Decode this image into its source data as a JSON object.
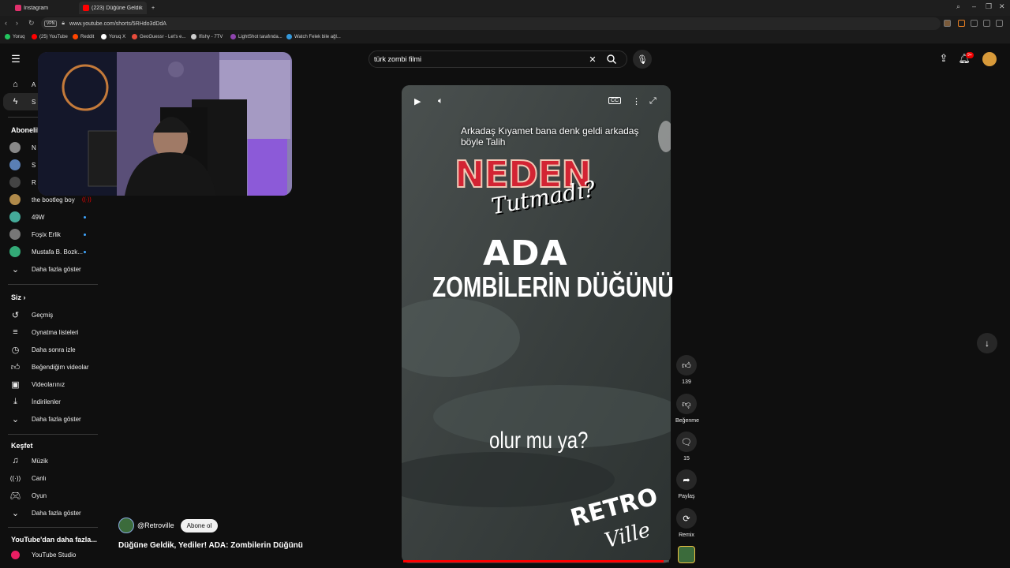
{
  "browser": {
    "tabs": [
      {
        "label": "Instagram",
        "color": "#e1306c"
      },
      {
        "label": "(223) Düğüne Geldik, Yedi",
        "color": "#ff0000"
      }
    ],
    "new_tab": "+",
    "vpn_badge": "VPN",
    "url": "www.youtube.com/shorts/5RHdo3dDdA",
    "bookmarks": [
      {
        "label": "Yoruq",
        "color": "#22c55e"
      },
      {
        "label": "(25) YouTube",
        "color": "#ff0000"
      },
      {
        "label": "Reddit",
        "color": "#ff4500"
      },
      {
        "label": "Yoruq X",
        "color": "#ffffff"
      },
      {
        "label": "GeoGuessr - Let's e...",
        "color": "#e74c3c"
      },
      {
        "label": "Ifishy - 7TV",
        "color": "#cccccc"
      },
      {
        "label": "LightShot tarafında...",
        "color": "#8e44ad"
      },
      {
        "label": "Watch Felek bile ağl...",
        "color": "#3498db"
      }
    ]
  },
  "search": {
    "value": "türk zombi filmi"
  },
  "header": {
    "notif_count": "9+"
  },
  "sidebar": {
    "home_initial": "A",
    "shorts_initial": "S",
    "subs_head": "Abonelil",
    "subs": [
      {
        "label": "N",
        "color": "#888"
      },
      {
        "label": "S",
        "color": "#5a7fb5"
      },
      {
        "label": "R",
        "color": "#444"
      },
      {
        "label": "the bootleg boy",
        "color": "#b08a4a",
        "live": true
      },
      {
        "label": "49W",
        "color": "#4a9",
        "dot": true
      },
      {
        "label": "Foşix Erlik",
        "color": "#777",
        "dot": true
      },
      {
        "label": "Mustafa B. Bozk...",
        "color": "#3a7",
        "dot": true
      }
    ],
    "show_more_1": "Daha fazla göster",
    "siz_head": "Siz",
    "siz_items": [
      {
        "label": "Geçmiş",
        "icon": "history-icon"
      },
      {
        "label": "Oynatma listeleri",
        "icon": "playlist-icon"
      },
      {
        "label": "Daha sonra izle",
        "icon": "clock-icon"
      },
      {
        "label": "Beğendiğim videolar",
        "icon": "thumbs-up-icon"
      },
      {
        "label": "Videolarınız",
        "icon": "video-icon"
      },
      {
        "label": "İndirilenler",
        "icon": "download-icon"
      }
    ],
    "show_more_2": "Daha fazla göster",
    "explore_head": "Keşfet",
    "explore_items": [
      {
        "label": "Müzik",
        "icon": "music-icon"
      },
      {
        "label": "Canlı",
        "icon": "live-icon"
      },
      {
        "label": "Oyun",
        "icon": "game-icon"
      }
    ],
    "show_more_3": "Daha fazla göster",
    "more_head": "YouTube'dan daha fazla...",
    "studio": "YouTube Studio"
  },
  "video": {
    "caption": "Arkadaş Kıyamet bana denk geldi arkadaş böyle Talih",
    "neden": "NEDEN",
    "tutmadi": "Tutmadı?",
    "ada": "ADA",
    "subtitle": "ZOMBİLERİN DÜĞÜNÜ",
    "olur": "olur mu ya?",
    "logo_retro": "RETRO",
    "logo_ville": "Ville",
    "progress": 0.98
  },
  "actions": {
    "likes": "139",
    "dislike_label": "Beğenme",
    "comments": "15",
    "share_label": "Paylaş",
    "remix_label": "Remix"
  },
  "channel": {
    "handle": "@Retroville",
    "subscribe_label": "Abone ol"
  },
  "title": "Düğüne Geldik, Yediler! ADA: Zombilerin Düğünü"
}
